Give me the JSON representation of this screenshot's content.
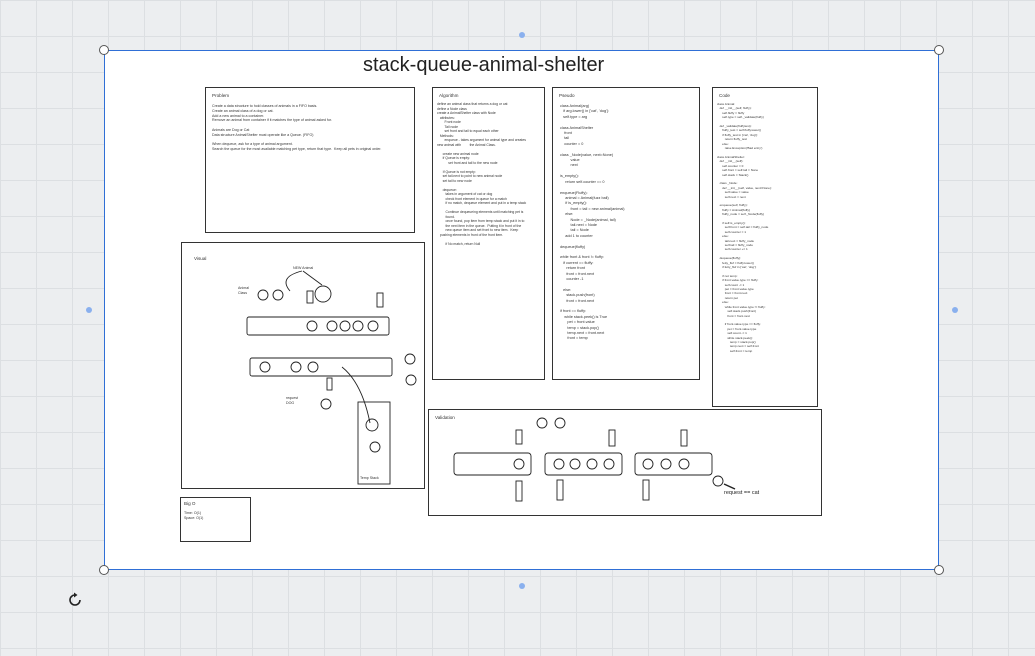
{
  "title": "stack-queue-animal-shelter",
  "panels": {
    "problem": {
      "heading": "Problem",
      "lines": "Create a data structure to hold classes of animals in a FIFO basis.\nCreate an animal class of a dog or cat.\nAdd a new animal to a container.\nRemove an animal from container if it matches the type of animal asked for.\n\nAnimals are Dog or Cat\nData structure AnimalShelter must operate like a Queue. (FIFO)\n\nWhen dequeue, ask for a type of animal argument.\nSearch the queue for the most available matching pet type, return that type.  Keep all pets in original order."
    },
    "algorithm": {
      "heading": "Algorithm",
      "lines": "define an animal class that returns a dog or cat\ndefine a Node class\ncreate a AnimalShelter class with Node\n   attributes:\n        Front node\n        Tail node\n        set front and tail to equal each other\n   Methods:\n        enqueue - takes argument for animal type and creates\nnew animal with         the Animal Class.\n\n      create new animal node\n      if Queue is empty:\n            set front and tail to the new node\n\n      If Queue is not empty:\n      set tail.next to point to new animal node\n      set tail to new node\n\n      dequeue:\n         takes in argument of cat or dog\n         check front element in queue for a match\n         if no match, dequeue element and put in a temp stack\n\n         Continue dequeueing elements until matching pet is\n         found.\n         once found, pop item from temp stack and put it in to\n         the next item in the queue.  Putting it in front of the\n         new queue item and set front to new item.  Keep\n   pushing elements in front of the front item.\n\n         if No match, return Null"
    },
    "pseudo": {
      "heading": "Pseudo",
      "lines": "class Animal(arg)\n   if arg.lower() in ['cat', 'dog']:\n   self.type = arg\n\nclass AnimalShelter\n    front\n    tail\n    counter = 0\n\nclass _Node(value, next=None)\n          value\n          next\n\nis_empty():\n     return self.counter == 0\n\nenqueue(Fluffy):\n     animal = Animal(fuzz ball)\n     if is_empty():\n          front = tail = new animal(animal)\n     else:\n          Node = _Node(animal, tail)\n          tail.next = Node\n          tail = Node\n     add 1 to counter\n\ndequeue(fluffy)\n\nwhile front & front != fluffy:\n   if current == fluffy:\n      return front\n      front = front.next\n      counter -1\n\n   else:\n      stack.push(front)\n      front = front.next\n\nif front == fluffy:\n    while stack.peek() is True\n       pet = front.value\n       temp = stack.pop()\n       temp.next = front.next\n       front = temp"
    },
    "code": {
      "heading": "Code",
      "lines": "class Animal:\n   def __init__(self, fluffy):\n      self.fluffy = fluffy\n      self.type = self._validate(fluffy)\n\n   def _validate(fluffytest):\n      fluffy_test = self.fluffy.lower()\n      if fluffy_test in ['cat', 'dog']:\n         return fluffy_test\n      else:\n         raise Exception('Bad entry')\n\nclass AnimalShelter:\n   def __init__(self):\n      self.counter = 0\n      self.front = self.tail = None\n      self.stack = Stack()\n\n   class _Node:\n      def __init__(self, value, next=None):\n         self.value = value\n         self.next = next\n\n   enqueue(self, fluffy):\n      fluffy = Animal(fluffy)\n      fluffy_node = self._Node(fluffy)\n\n      if self.is_empty():\n         self.front = self.tail = fluffy_node\n         self.counter = 1\n      else:\n         tail.next = fluffy_node\n         self.tail = fluffy_node\n         self.counter += 1\n\n   dequeue(fluffy):\n      fetty_fluf = fluffy.lower()\n      if fetty_fluf in ['cat', 'dog']:\n\n      if not temp:\n      if front.value.type == fluffy:\n         self.count -= 1\n         pet = front.value.type\n         front = front.next\n         return pet\n      else:\n         while front.value.type != fluffy:\n            self.stack.push(front)\n            front = front.next\n\n         if front.value.type == fluffy:\n            pet = front.value.type\n            self.count -= 1\n            while stack.peek():\n               temp = stack.pop()\n               temp.next = self.front\n               self.front = temp"
    },
    "visual": {
      "heading": "Visual",
      "new_animal_label": "NEW Animal",
      "animal_class_label": "Animal\nClass",
      "request_label": "request\nDOG",
      "temp_stack_label": "Temp Stack"
    },
    "validation": {
      "heading": "Validation",
      "request_label": "request == cat"
    },
    "bigo": {
      "heading": "Big O",
      "lines": "Time: O(1)\nSpace: O(1)"
    }
  }
}
